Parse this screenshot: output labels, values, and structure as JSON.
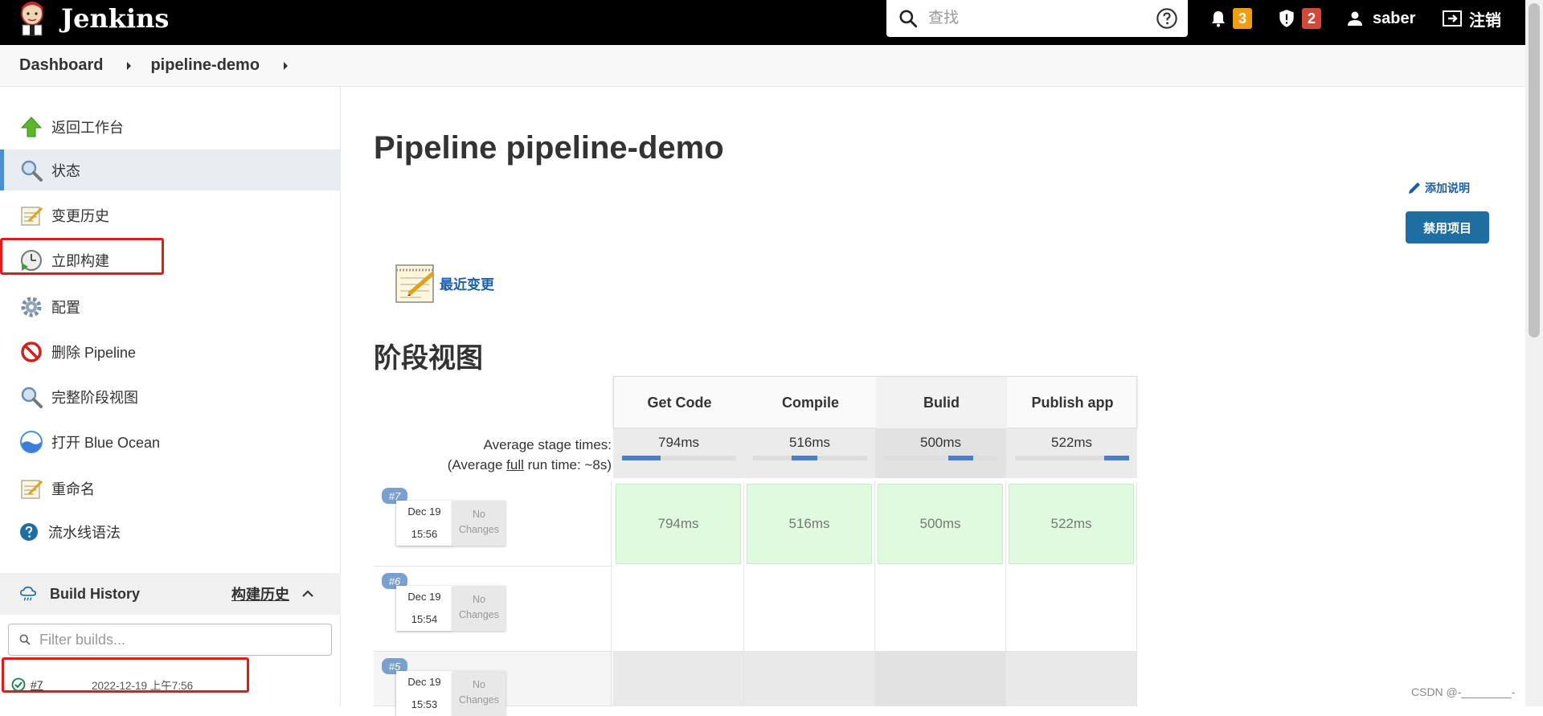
{
  "header": {
    "app_name": "Jenkins",
    "search_placeholder": "查找",
    "notifications_count": "3",
    "security_count": "2",
    "user": "saber",
    "logout": "注销"
  },
  "breadcrumb": [
    "Dashboard",
    "pipeline-demo"
  ],
  "sidebar": {
    "items": [
      {
        "label": "返回工作台",
        "icon": "up-arrow-icon"
      },
      {
        "label": "状态",
        "icon": "magnifier-icon"
      },
      {
        "label": "变更历史",
        "icon": "notepad-icon"
      },
      {
        "label": "立即构建",
        "icon": "clock-play-icon"
      },
      {
        "label": "配置",
        "icon": "gear-icon"
      },
      {
        "label": "删除 Pipeline",
        "icon": "no-entry-icon"
      },
      {
        "label": "完整阶段视图",
        "icon": "magnifier-icon"
      },
      {
        "label": "打开 Blue Ocean",
        "icon": "blue-ocean-icon"
      },
      {
        "label": "重命名",
        "icon": "notepad-icon"
      },
      {
        "label": "流水线语法",
        "icon": "help-icon"
      }
    ],
    "build_history": {
      "title": "Build History",
      "trend": "构建历史",
      "filter_placeholder": "Filter builds...",
      "builds": [
        {
          "number": "#7",
          "date": "2022-12-19 上午7:56",
          "status": "success"
        }
      ]
    }
  },
  "main": {
    "title": "Pipeline pipeline-demo",
    "add_description": "添加说明",
    "disable_project": "禁用项目",
    "recent_changes": "最近变更",
    "stage_view_title": "阶段视图"
  },
  "stage_view": {
    "stages": [
      "Get Code",
      "Compile",
      "Bulid",
      "Publish app"
    ],
    "avg_label_line1": "Average stage times:",
    "avg_label_prefix": "(Average ",
    "avg_label_link": "full",
    "avg_label_suffix": " run time: ~8s)",
    "avg_times": [
      "794ms",
      "516ms",
      "500ms",
      "522ms"
    ],
    "builds": [
      {
        "badge": "#7",
        "month_day": "Dec 19",
        "time": "15:56",
        "changes": "No Changes",
        "durations": [
          "794ms",
          "516ms",
          "500ms",
          "522ms"
        ]
      },
      {
        "badge": "#6",
        "month_day": "Dec 19",
        "time": "15:54",
        "changes": "No Changes",
        "durations": []
      },
      {
        "badge": "#5",
        "month_day": "Dec 19",
        "time": "15:53",
        "changes": "No Changes",
        "durations": []
      }
    ]
  },
  "watermark": "CSDN @-________-"
}
